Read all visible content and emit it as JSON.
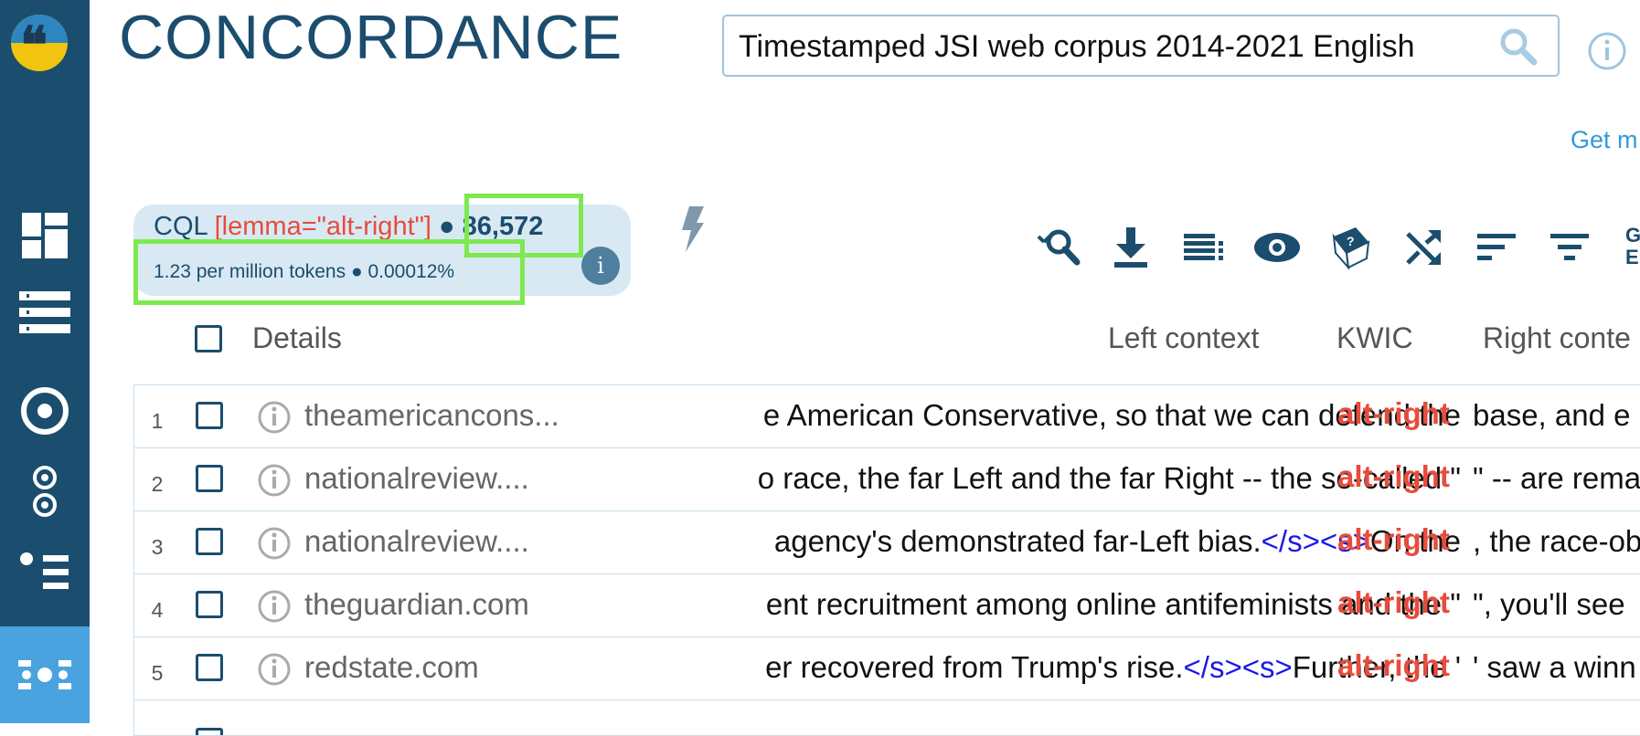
{
  "app": {
    "title": "CONCORDANCE"
  },
  "corpus": {
    "name": "Timestamped JSI web corpus 2014-2021 English"
  },
  "get_more_link": "Get m",
  "sidebar": {
    "items": [
      {
        "name": "dashboard"
      },
      {
        "name": "wordlist"
      },
      {
        "name": "keywords"
      },
      {
        "name": "word-sketch"
      },
      {
        "name": "thesaurus"
      },
      {
        "name": "concordance",
        "active": true
      }
    ]
  },
  "query": {
    "label": "CQL",
    "expression": "[lemma=\"alt-right\"]",
    "separator": "●",
    "count": "86,572",
    "stats": "1.23 per million tokens ● 0.00012%"
  },
  "toolbar": {
    "icons": [
      "search-again-icon",
      "download-icon",
      "view-options-icon",
      "visibility-icon",
      "random-sample-icon",
      "shuffle-icon",
      "sort-icon",
      "filter-icon"
    ],
    "more_label": "G\nE"
  },
  "table": {
    "headers": {
      "details": "Details",
      "left": "Left context",
      "kwic": "KWIC",
      "right": "Right conte"
    },
    "rows": [
      {
        "num": "1",
        "source": "theamericancons...",
        "left": "e American Conservative, so that we can defend the",
        "kwic": "alt-right",
        "right": "base, and e"
      },
      {
        "num": "2",
        "source": "nationalreview....",
        "left": "o race, the far Left and the far Right -- the so-called \"",
        "kwic": "alt-right",
        "right": "\" -- are rema"
      },
      {
        "num": "3",
        "source": "nationalreview....",
        "left_pre": " agency's demonstrated far-Left bias.",
        "left_tag": "</s><s>",
        "left_post": "On the",
        "kwic": "alt-right",
        "right": ", the race-ob"
      },
      {
        "num": "4",
        "source": "theguardian.com",
        "left": "ent recruitment among online antifeminists and the \"",
        "kwic": "alt-right",
        "right": "\", you'll see"
      },
      {
        "num": "5",
        "source": "redstate.com",
        "left_pre": "er recovered from Trump's rise.",
        "left_tag": "</s><s>",
        "left_post": "Further, the '",
        "kwic": "alt-right",
        "right": "' saw a winn"
      }
    ]
  },
  "colors": {
    "sidebar": "#1b4d6e",
    "sidebar_active": "#4aa3df",
    "kwic": "#e74c3c",
    "highlight": "#7ee84f",
    "link": "#3498db"
  }
}
